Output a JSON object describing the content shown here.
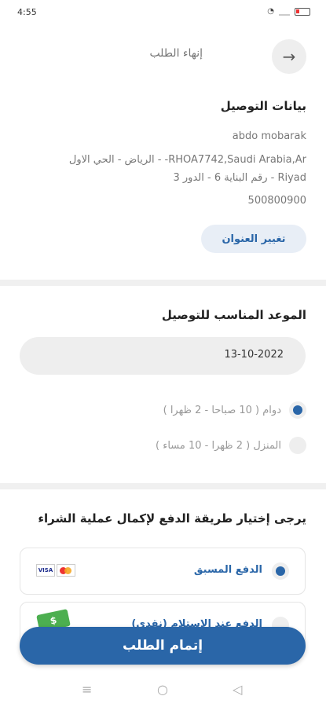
{
  "status_bar": {
    "time": "4:55"
  },
  "header": {
    "title": "إنهاء الطلب"
  },
  "delivery": {
    "title": "بيانات التوصيل",
    "name": "abdo mobarak",
    "address_line1": "RHOA7742,Saudi Arabia,Ar- - الرياض - الحي الاول",
    "address_line2": "Riyad - رقم البناية 6  - الدور 3",
    "phone": "500800900",
    "change_button": "تغيير العنوان"
  },
  "schedule": {
    "title": "الموعد المناسب للتوصيل",
    "date": "13-10-2022",
    "options": [
      {
        "label": "دوام ( 10 صباحا - 2 ظهرا )",
        "selected": true
      },
      {
        "label": "المنزل ( 2 ظهرا - 10 مساء )",
        "selected": false
      }
    ]
  },
  "payment": {
    "title": "يرجى إختيار طريقة الدفع لإكمال عملية الشراء",
    "options": [
      {
        "label": "الدفع المسبق",
        "icon": "visa-mastercard-icon",
        "selected": true
      },
      {
        "label": "الدفع عند الإستلام (نقدي)",
        "icon": "cash-icon",
        "selected": false
      }
    ]
  },
  "submit_button": "إتمام الطلب",
  "colors": {
    "accent": "#2a66a8",
    "button_bg": "#e8eef6"
  }
}
